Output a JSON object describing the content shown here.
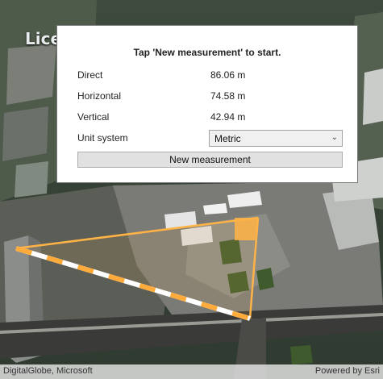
{
  "map": {
    "overlay_label": "Lice",
    "attribution_left": "DigitalGlobe, Microsoft",
    "attribution_right": "Powered by Esri",
    "measurement_line_color": "#ffb347"
  },
  "panel": {
    "instruction": "Tap 'New measurement' to start.",
    "rows": [
      {
        "label": "Direct",
        "value": "86.06 m"
      },
      {
        "label": "Horizontal",
        "value": "74.58 m"
      },
      {
        "label": "Vertical",
        "value": "42.94 m"
      }
    ],
    "unit_label": "Unit system",
    "unit_selected": "Metric",
    "new_button_label": "New measurement"
  }
}
